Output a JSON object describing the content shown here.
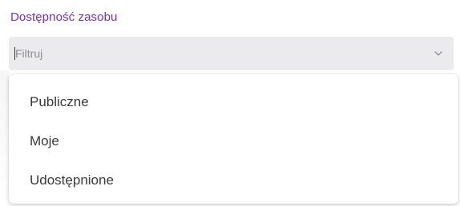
{
  "field": {
    "label": "Dostępność zasobu",
    "placeholder": "Filtruj",
    "value": ""
  },
  "icons": {
    "toggle": "chevron-down-icon"
  },
  "colors": {
    "label": "#7b2cbf",
    "input_background": "#ebebed",
    "option_text": "#3a3a3c"
  },
  "dropdown": {
    "options": [
      {
        "label": "Publiczne"
      },
      {
        "label": "Moje"
      },
      {
        "label": "Udostępnione"
      }
    ]
  }
}
